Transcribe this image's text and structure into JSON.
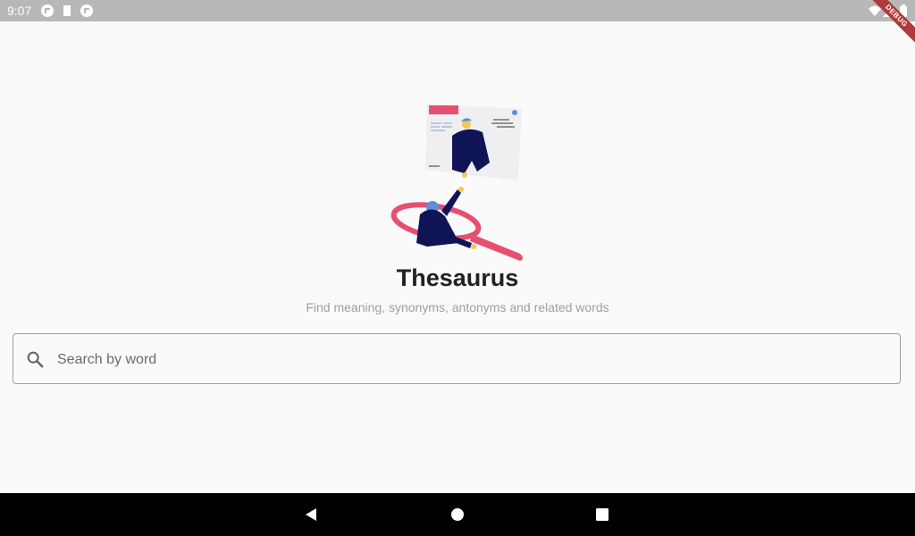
{
  "status_bar": {
    "time": "9:07",
    "left_icons": [
      "app-notification-icon",
      "sd-card-icon",
      "app-notification-icon"
    ],
    "right_icons": [
      "wifi-icon",
      "signal-icon",
      "battery-icon"
    ],
    "debug_label": "DEBUG"
  },
  "main": {
    "title": "Thesaurus",
    "subtitle": "Find meaning, synonyms, antonyms and related words",
    "search": {
      "placeholder": "Search by word",
      "value": ""
    }
  },
  "navigation": {
    "buttons": [
      "back-icon",
      "home-icon",
      "recents-icon"
    ]
  },
  "colors": {
    "accent": "#e6506e",
    "figure_dark": "#0f1456",
    "figure_hair": "#5b8fe0",
    "status_bar": "#b8b8b8",
    "nav_bar": "#000000"
  }
}
